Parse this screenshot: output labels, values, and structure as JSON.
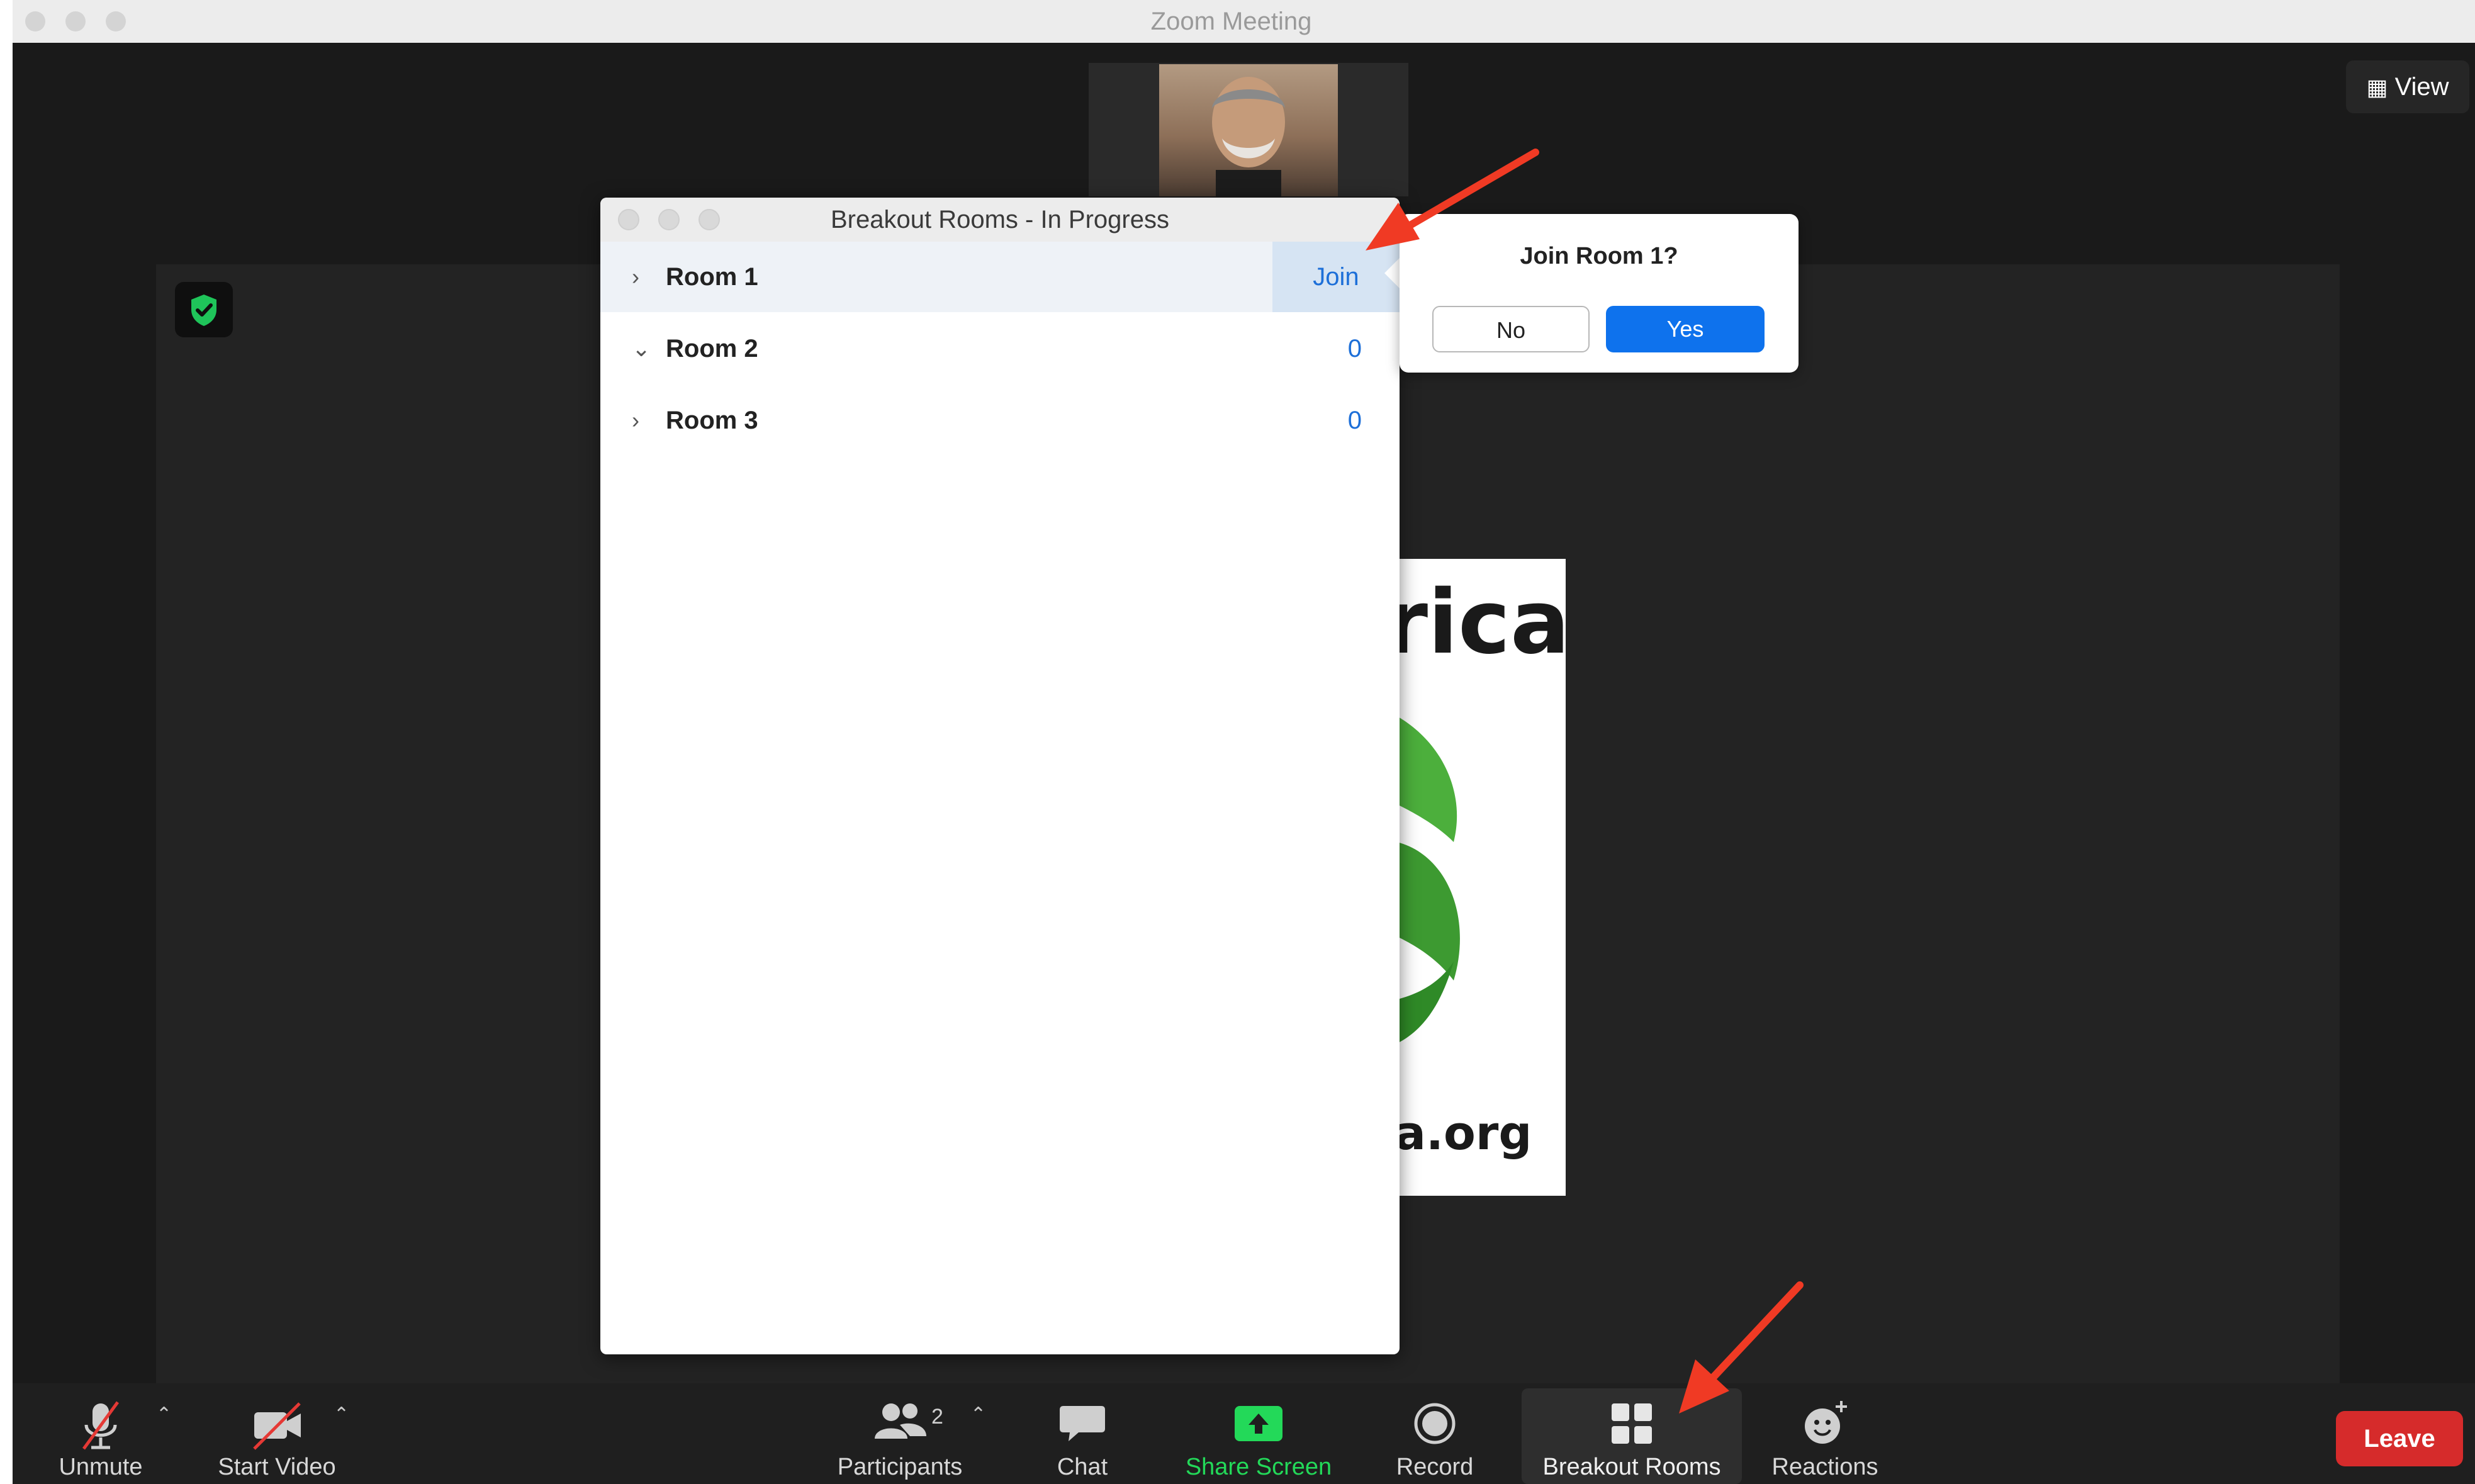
{
  "window": {
    "title": "Zoom Meeting"
  },
  "header": {
    "view_label": "View"
  },
  "shared_content": {
    "text_top": "rica",
    "text_bottom": "a.org"
  },
  "breakout_dialog": {
    "title": "Breakout Rooms - In Progress",
    "rooms": [
      {
        "label": "Room 1",
        "chevron": "›",
        "action": "Join"
      },
      {
        "label": "Room 2",
        "chevron": "⌄",
        "count": "0"
      },
      {
        "label": "Room 3",
        "chevron": "›",
        "count": "0"
      }
    ]
  },
  "join_popover": {
    "title": "Join Room 1?",
    "no_label": "No",
    "yes_label": "Yes"
  },
  "toolbar": {
    "unmute": "Unmute",
    "start_video": "Start Video",
    "participants": "Participants",
    "participants_count": "2",
    "chat": "Chat",
    "share_screen": "Share Screen",
    "record": "Record",
    "breakout_rooms": "Breakout Rooms",
    "reactions": "Reactions",
    "leave": "Leave"
  },
  "colors": {
    "accent_blue": "#0e72ed",
    "share_green": "#23d959",
    "leave_red": "#d62b2b",
    "annotation_red": "#f03a24"
  }
}
